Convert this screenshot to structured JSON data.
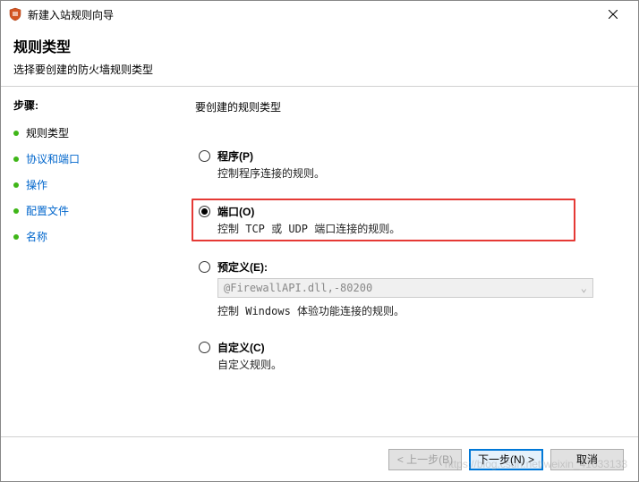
{
  "window": {
    "title": "新建入站规则向导",
    "close_tooltip": "Close"
  },
  "header": {
    "title": "规则类型",
    "subtitle": "选择要创建的防火墙规则类型"
  },
  "sidebar": {
    "title": "步骤:",
    "steps": [
      {
        "label": "规则类型",
        "state": "current"
      },
      {
        "label": "协议和端口",
        "state": "link"
      },
      {
        "label": "操作",
        "state": "link"
      },
      {
        "label": "配置文件",
        "state": "link"
      },
      {
        "label": "名称",
        "state": "link"
      }
    ]
  },
  "main": {
    "prompt": "要创建的规则类型",
    "options": [
      {
        "id": "program",
        "title": "程序(P)",
        "desc": "控制程序连接的规则。",
        "checked": false
      },
      {
        "id": "port",
        "title": "端口(O)",
        "desc": "控制 TCP 或 UDP 端口连接的规则。",
        "checked": true,
        "highlighted": true
      },
      {
        "id": "predefined",
        "title": "预定义(E):",
        "desc": "控制 Windows 体验功能连接的规则。",
        "checked": false,
        "combo_value": "@FirewallAPI.dll,-80200"
      },
      {
        "id": "custom",
        "title": "自定义(C)",
        "desc": "自定义规则。",
        "checked": false
      }
    ]
  },
  "footer": {
    "back": "< 上一步(B)",
    "next": "下一步(N) >",
    "cancel": "取消"
  },
  "watermark": "https://blog.csdn.net/weixin_41633133"
}
